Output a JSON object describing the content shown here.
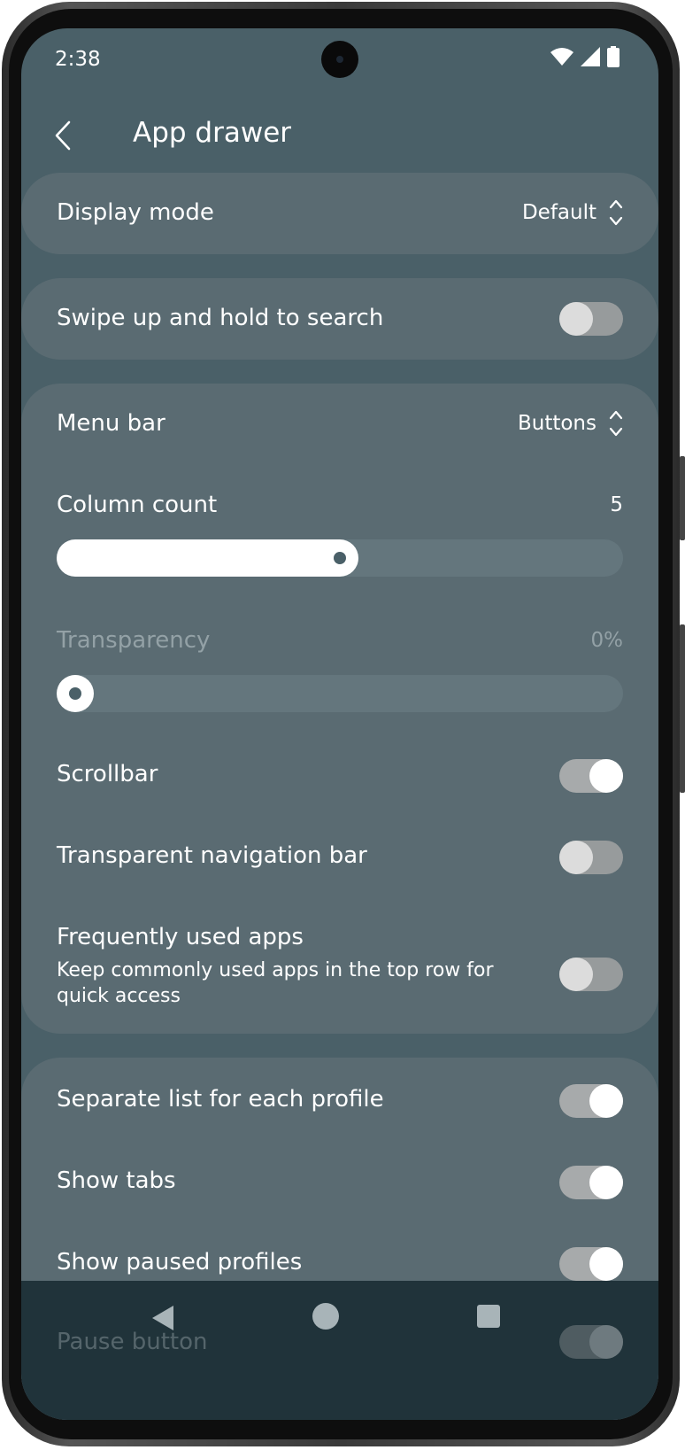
{
  "status_bar": {
    "time": "2:38",
    "icons": [
      "wifi-icon",
      "signal-icon",
      "battery-icon"
    ]
  },
  "app_bar": {
    "back_icon": "back-arrow-icon",
    "title": "App drawer"
  },
  "display_mode": {
    "label": "Display mode",
    "value": "Default"
  },
  "swipe_search": {
    "label": "Swipe up and hold to search",
    "enabled": false
  },
  "menu_bar": {
    "label": "Menu bar",
    "value": "Buttons"
  },
  "column_count": {
    "label": "Column count",
    "value": "5",
    "fraction": 0.5
  },
  "transparency": {
    "label": "Transparency",
    "value": "0%",
    "fraction": 0
  },
  "scrollbar": {
    "label": "Scrollbar",
    "enabled": true
  },
  "transparent_nav": {
    "label": "Transparent navigation bar",
    "enabled": false
  },
  "frequent_apps": {
    "label": "Frequently used apps",
    "description": "Keep commonly used apps in the top row for quick access",
    "enabled": false
  },
  "separate_list": {
    "label": "Separate list for each profile",
    "enabled": true
  },
  "show_tabs": {
    "label": "Show tabs",
    "enabled": true
  },
  "show_paused": {
    "label": "Show paused profiles",
    "enabled": true
  },
  "pause_button": {
    "label": "Pause button",
    "enabled": true
  },
  "nav_bar": {
    "buttons": [
      "back-triangle-icon",
      "home-circle-icon",
      "recents-square-icon"
    ]
  },
  "colors": {
    "background": "#4a6068",
    "card": "#5a6b72",
    "nav_bar": "#20333a",
    "text": "#ffffff",
    "disabled_text": "#93a1a6"
  }
}
